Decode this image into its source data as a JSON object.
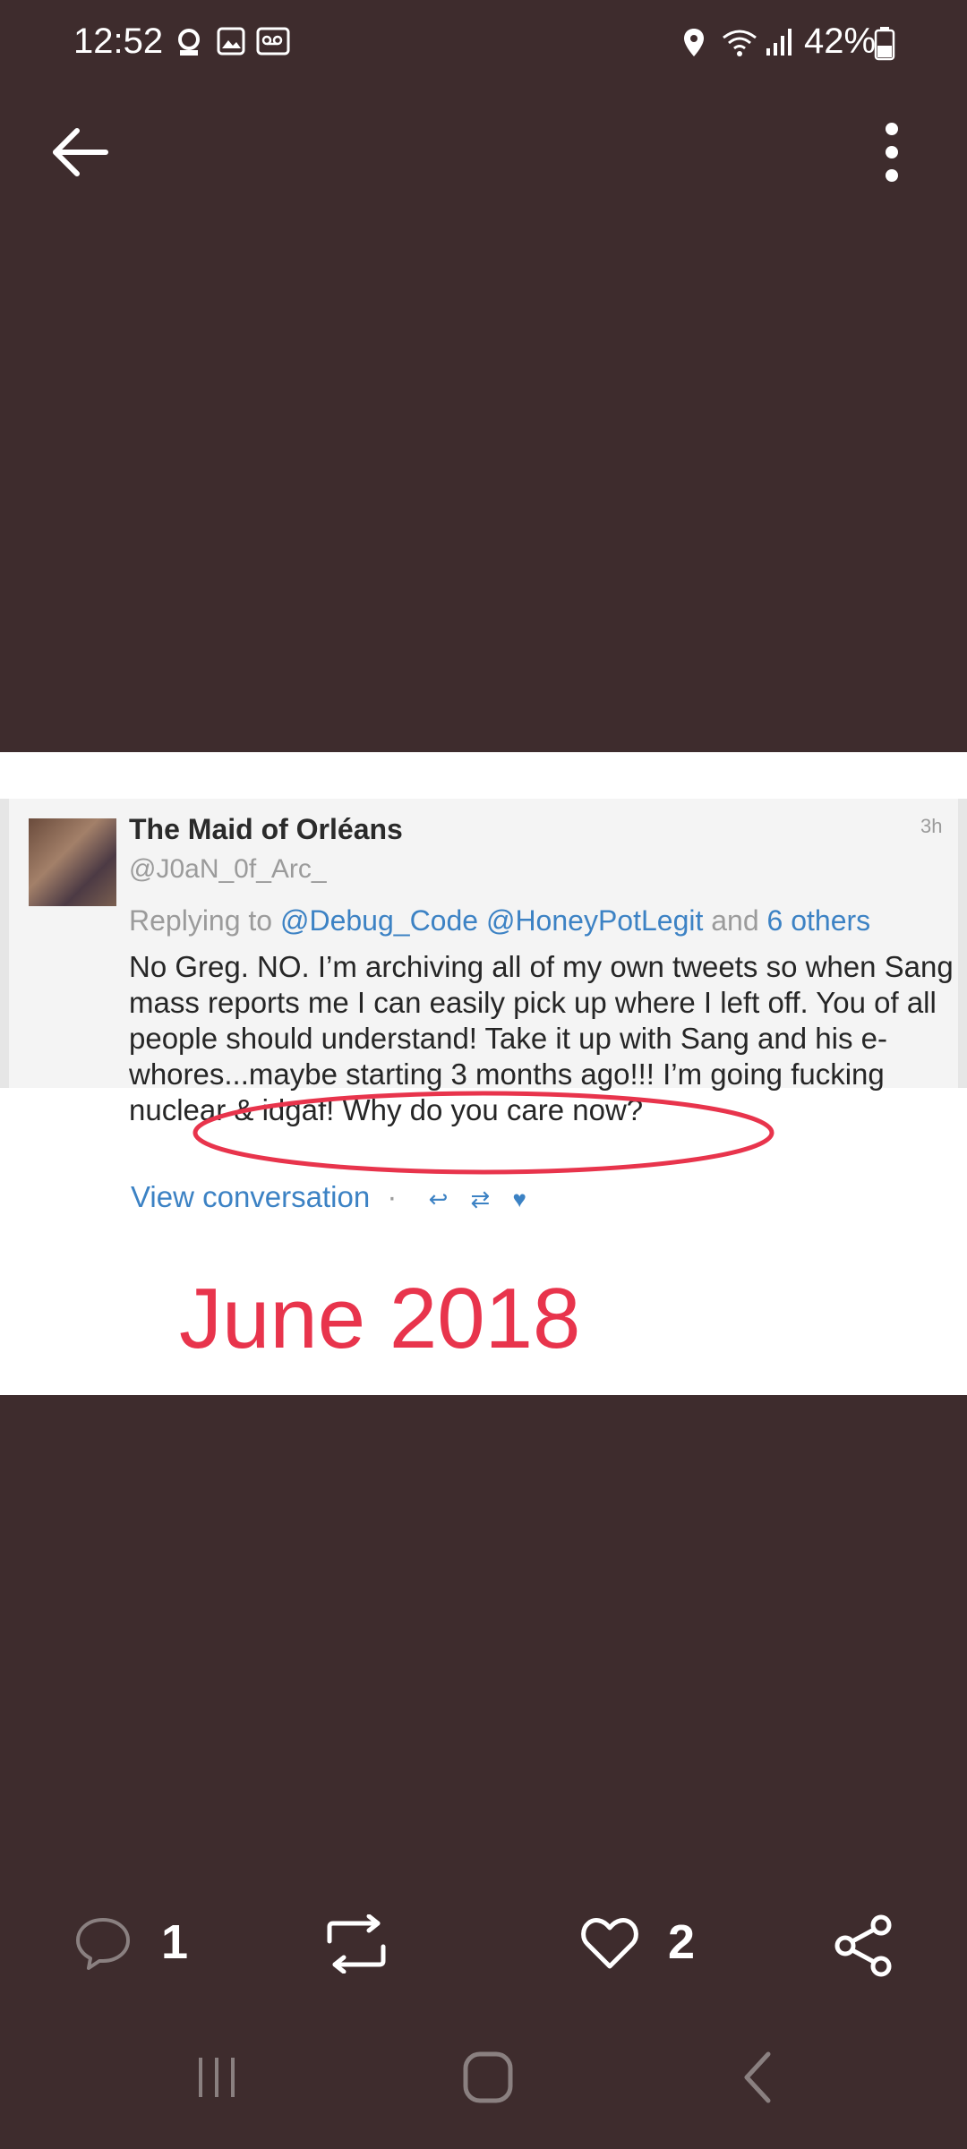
{
  "status": {
    "time": "12:52",
    "battery": "42%"
  },
  "post": {
    "tweet": {
      "name": "The Maid of Orléans",
      "handle": "@J0aN_0f_Arc_",
      "time": "3h",
      "reply_prefix": "Replying to",
      "reply_user1": "@Debug_Code",
      "reply_user2": "@HoneyPotLegit",
      "reply_and": "and",
      "reply_others": "6 others",
      "text": "No Greg. NO. I’m archiving all of my own tweets so when Sang mass reports me I can easily pick up where I left off. You of all people should understand! Take it up with Sang and his e-whores...maybe starting 3 months ago!!! I’m going fucking nuclear & idgaf! Why do you care now?",
      "view_conversation": "View conversation"
    },
    "caption": "June 2018"
  },
  "actions": {
    "comments": "1",
    "likes": "2"
  },
  "colors": {
    "background": "#3e2c2d",
    "link_blue": "#3c82c4",
    "annotation_red": "#e8344c"
  }
}
